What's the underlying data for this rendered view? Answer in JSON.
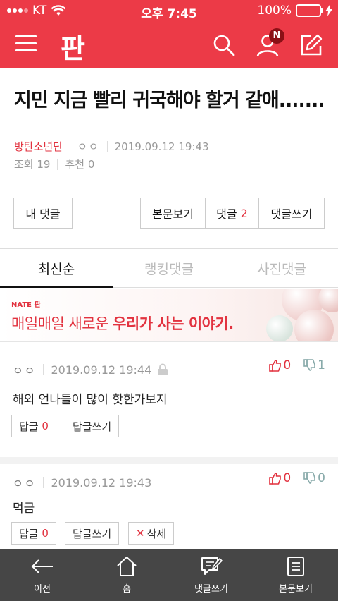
{
  "status_bar": {
    "carrier": "KT",
    "time": "오후 7:45",
    "battery": "100%",
    "battery_color": "#4cd964"
  },
  "header": {
    "logo": "판",
    "brand_color": "#ec3a47",
    "notification_badge": "N"
  },
  "post": {
    "title": "지민 지금 빨리 귀국해야 할거 같애.......",
    "category": "방탄소년단",
    "author": "ㅇㅇ",
    "datetime": "2019.09.12 19:43",
    "views_label": "조회 19",
    "recommend_label": "추천 0"
  },
  "actions": {
    "my_comments": "내 댓글",
    "view_body": "본문보기",
    "comments_label": "댓글",
    "comments_count": "2",
    "write_comment": "댓글쓰기"
  },
  "tabs": [
    "최신순",
    "랭킹댓글",
    "사진댓글"
  ],
  "banner": {
    "brand": "NATE 판",
    "text_plain": "매일매일 새로운 ",
    "text_bold": "우리가 사는 이야기."
  },
  "comments": [
    {
      "author": "ㅇㅇ",
      "datetime": "2019.09.12 19:44",
      "up": "0",
      "down": "1",
      "body": "해외 언나들이 많이 핫한가보지",
      "reply_label": "답글",
      "reply_count": "0",
      "write_reply": "답글쓰기"
    },
    {
      "author": "ㅇㅇ",
      "datetime": "2019.09.12 19:43",
      "up": "0",
      "down": "0",
      "body": "먹금",
      "reply_label": "답글",
      "reply_count": "0",
      "write_reply": "답글쓰기",
      "delete_label": "삭제"
    }
  ],
  "bottom_nav": [
    {
      "label": "이전",
      "icon": "back-arrow-icon"
    },
    {
      "label": "홈",
      "icon": "home-icon"
    },
    {
      "label": "댓글쓰기",
      "icon": "write-comment-icon"
    },
    {
      "label": "본문보기",
      "icon": "document-icon"
    }
  ]
}
